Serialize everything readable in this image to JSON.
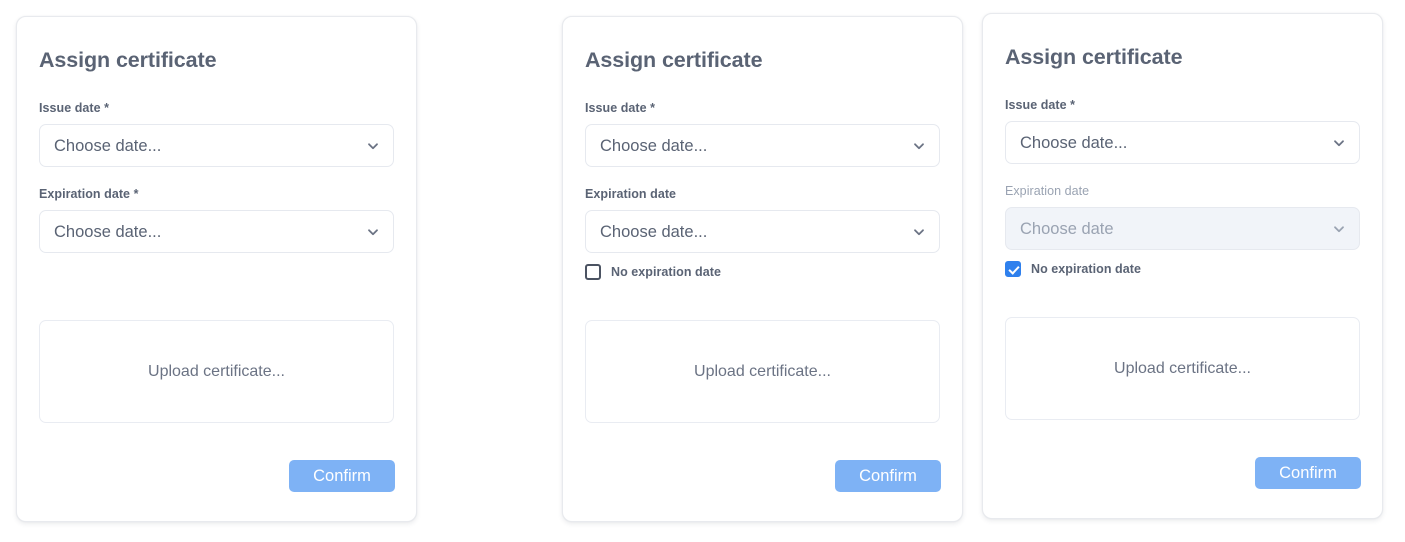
{
  "colors": {
    "title": "#5a6374",
    "label": "#5a6374",
    "label_disabled": "#9aa3b2",
    "field_border": "#e6e9ef",
    "field_disabled_bg": "#f1f4f9",
    "checkbox_checked": "#2f80ed",
    "checkbox_border": "#4b5362",
    "confirm_button": "#7eb2f5",
    "card_border": "#e8eaee",
    "page_background": "#ffffff"
  },
  "icons": {
    "chevron": "chevron-down-icon",
    "check": "check-icon"
  },
  "cards": [
    {
      "title": "Assign certificate",
      "issue": {
        "label": "Issue date *",
        "value": "Choose date...",
        "disabled": false
      },
      "expiration": {
        "label": "Expiration date *",
        "value": "Choose date...",
        "disabled": false
      },
      "checkbox": {
        "visible": false,
        "label": "No expiration date",
        "checked": false
      },
      "dropzone": {
        "text": "Upload certificate..."
      },
      "confirm": {
        "label": "Confirm"
      }
    },
    {
      "title": "Assign certificate",
      "issue": {
        "label": "Issue date *",
        "value": "Choose date...",
        "disabled": false
      },
      "expiration": {
        "label": "Expiration date",
        "value": "Choose date...",
        "disabled": false
      },
      "checkbox": {
        "visible": true,
        "label": "No expiration date",
        "checked": false
      },
      "dropzone": {
        "text": "Upload certificate..."
      },
      "confirm": {
        "label": "Confirm"
      }
    },
    {
      "title": "Assign certificate",
      "issue": {
        "label": "Issue date *",
        "value": "Choose date...",
        "disabled": false
      },
      "expiration": {
        "label": "Expiration date",
        "value": "Choose date",
        "disabled": true
      },
      "checkbox": {
        "visible": true,
        "label": "No expiration date",
        "checked": true
      },
      "dropzone": {
        "text": "Upload certificate..."
      },
      "confirm": {
        "label": "Confirm"
      }
    }
  ]
}
